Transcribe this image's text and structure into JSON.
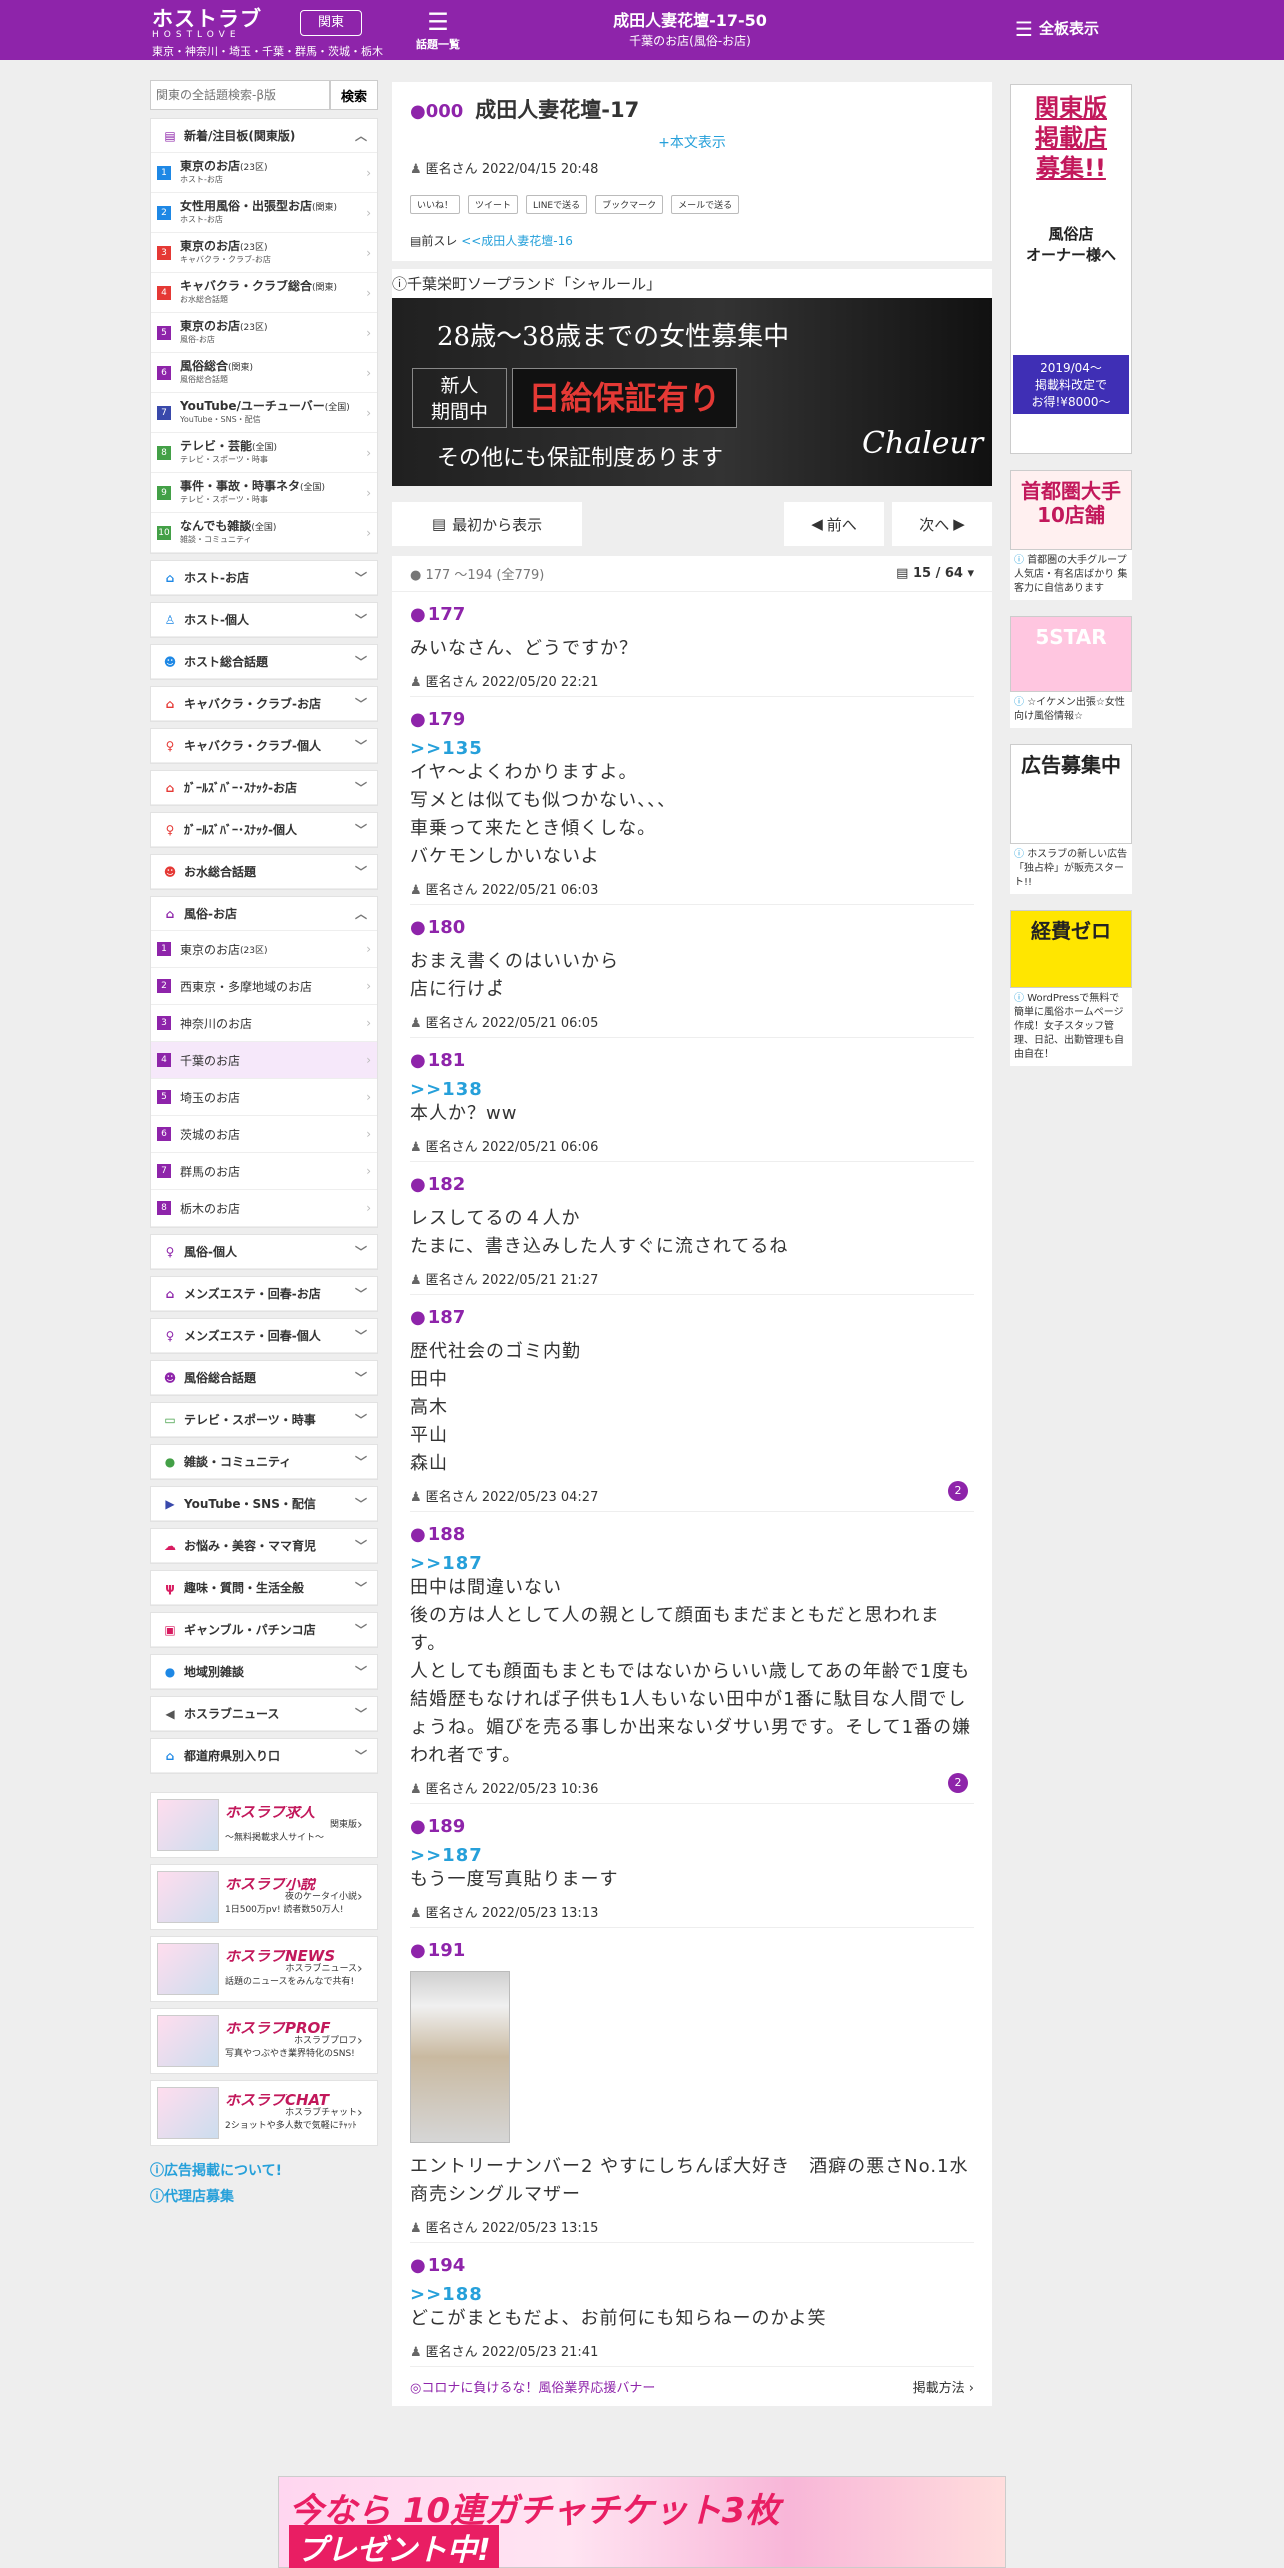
{
  "header": {
    "logo_jp": "ホストラブ",
    "logo_en": "HOSTLOVE",
    "region_btn": "関東",
    "areas": "東京・神奈川・埼玉・千葉・群馬・茨城・栃木",
    "topics_label": "話題一覧",
    "title": "成田人妻花壇-17-50",
    "subtitle": "千葉のお店(風俗-お店)",
    "fullview": "全板表示"
  },
  "search": {
    "placeholder": "関東の全話題検索-β版",
    "button": "検索"
  },
  "sidebar": {
    "featured_title": "新着/注目板(関東版)",
    "featured": [
      {
        "n": "1",
        "main": "東京のお店",
        "small": "(23区)",
        "sub": "ホスト-お店",
        "color": "#1e88e5"
      },
      {
        "n": "2",
        "main": "女性用風俗・出張型お店",
        "small": "(関東)",
        "sub": "ホスト-お店",
        "color": "#1e88e5"
      },
      {
        "n": "3",
        "main": "東京のお店",
        "small": "(23区)",
        "sub": "キャバクラ・クラブ-お店",
        "color": "#e53935"
      },
      {
        "n": "4",
        "main": "キャバクラ・クラブ総合",
        "small": "(関東)",
        "sub": "お水総合話題",
        "color": "#e53935"
      },
      {
        "n": "5",
        "main": "東京のお店",
        "small": "(23区)",
        "sub": "風俗-お店",
        "color": "#8e24aa"
      },
      {
        "n": "6",
        "main": "風俗総合",
        "small": "(関東)",
        "sub": "風俗総合話題",
        "color": "#8e24aa"
      },
      {
        "n": "7",
        "main": "YouTube/ユーチューバー",
        "small": "(全国)",
        "sub": "YouTube・SNS・配信",
        "color": "#3949ab"
      },
      {
        "n": "8",
        "main": "テレビ・芸能",
        "small": "(全国)",
        "sub": "テレビ・スポーツ・時事",
        "color": "#43a047"
      },
      {
        "n": "9",
        "main": "事件・事故・時事ネタ",
        "small": "(全国)",
        "sub": "テレビ・スポーツ・時事",
        "color": "#43a047"
      },
      {
        "n": "10",
        "main": "なんでも雑談",
        "small": "(全国)",
        "sub": "雑談・コミュニティ",
        "color": "#43a047"
      }
    ],
    "cats_top": [
      {
        "label": "ホスト-お店",
        "icon": "home-icon",
        "glyph": "⌂",
        "color": "#1e88e5"
      },
      {
        "label": "ホスト-個人",
        "icon": "person-icon",
        "glyph": "♙",
        "color": "#1e88e5"
      },
      {
        "label": "ホスト総合話題",
        "icon": "group-icon",
        "glyph": "☻",
        "color": "#1e88e5"
      },
      {
        "label": "キャバクラ・クラブ-お店",
        "icon": "home-icon",
        "glyph": "⌂",
        "color": "#e53935"
      },
      {
        "label": "キャバクラ・クラブ-個人",
        "icon": "person-icon",
        "glyph": "♀",
        "color": "#e53935"
      },
      {
        "label": "ｶﾞｰﾙｽﾞﾊﾞｰ･ｽﾅｯｸ-お店",
        "icon": "home-icon",
        "glyph": "⌂",
        "color": "#e53935"
      },
      {
        "label": "ｶﾞｰﾙｽﾞﾊﾞｰ･ｽﾅｯｸ-個人",
        "icon": "person-icon",
        "glyph": "♀",
        "color": "#e53935"
      },
      {
        "label": "お水総合話題",
        "icon": "group-icon",
        "glyph": "☻",
        "color": "#e53935"
      }
    ],
    "fuzoku_title": "風俗-お店",
    "fuzoku": [
      {
        "n": "1",
        "label": "東京のお店",
        "small": "(23区)"
      },
      {
        "n": "2",
        "label": "西東京・多摩地域のお店",
        "small": ""
      },
      {
        "n": "3",
        "label": "神奈川のお店",
        "small": ""
      },
      {
        "n": "4",
        "label": "千葉のお店",
        "small": ""
      },
      {
        "n": "5",
        "label": "埼玉のお店",
        "small": ""
      },
      {
        "n": "6",
        "label": "茨城のお店",
        "small": ""
      },
      {
        "n": "7",
        "label": "群馬のお店",
        "small": ""
      },
      {
        "n": "8",
        "label": "栃木のお店",
        "small": ""
      }
    ],
    "cats_bottom": [
      {
        "label": "風俗-個人",
        "icon": "person-icon",
        "glyph": "♀",
        "color": "#8e24aa"
      },
      {
        "label": "メンズエステ・回春-お店",
        "icon": "home-icon",
        "glyph": "⌂",
        "color": "#8e24aa"
      },
      {
        "label": "メンズエステ・回春-個人",
        "icon": "person-icon",
        "glyph": "♀",
        "color": "#8e24aa"
      },
      {
        "label": "風俗総合話題",
        "icon": "group-icon",
        "glyph": "☻",
        "color": "#8e24aa"
      },
      {
        "label": "テレビ・スポーツ・時事",
        "icon": "tv-icon",
        "glyph": "▭",
        "color": "#43a047"
      },
      {
        "label": "雑談・コミュニティ",
        "icon": "chat-icon",
        "glyph": "●",
        "color": "#43a047"
      },
      {
        "label": "YouTube・SNS・配信",
        "icon": "youtube-icon",
        "glyph": "▶",
        "color": "#3949ab"
      },
      {
        "label": "お悩み・美容・ママ育児",
        "icon": "cloud-icon",
        "glyph": "☁",
        "color": "#d81b60"
      },
      {
        "label": "趣味・質問・生活全般",
        "icon": "utensils-icon",
        "glyph": "ψ",
        "color": "#d81b60"
      },
      {
        "label": "ギャンブル・パチンコ店",
        "icon": "money-icon",
        "glyph": "▣",
        "color": "#d81b60"
      },
      {
        "label": "地域別雑談",
        "icon": "chat-icon",
        "glyph": "●",
        "color": "#1e88e5"
      },
      {
        "label": "ホスラブニュース",
        "icon": "speaker-icon",
        "glyph": "◀",
        "color": "#555555"
      },
      {
        "label": "都道府県別入り口",
        "icon": "home-icon",
        "glyph": "⌂",
        "color": "#1e88e5"
      }
    ],
    "ads": [
      {
        "title": "ホスラブ求人",
        "sub1": "関東版",
        "sub2": "〜無料掲載求人サイト〜"
      },
      {
        "title": "ホスラブ小説",
        "sub1": "夜のケータイ小説",
        "sub2": "1日500万pv! 読者数50万人!"
      },
      {
        "title": "ホスラブNEWS",
        "sub1": "ホスラブニュース",
        "sub2": "話題のニュースをみんなで共有!"
      },
      {
        "title": "ホスラブPROF",
        "sub1": "ホスラブプロフ",
        "sub2": "写真やつぶやき業界特化のSNS!"
      },
      {
        "title": "ホスラブCHAT",
        "sub1": "ホスラブチャット",
        "sub2": "2ショットや多人数で気軽にﾁｬｯﾄ"
      }
    ],
    "link1": "広告掲載について!",
    "link2": "代理店募集"
  },
  "thread": {
    "no": "000",
    "title": "成田人妻花壇-17",
    "more": "+本文表示",
    "author": "匿名さん",
    "date": "2022/04/15 20:48",
    "share": [
      "いいね！",
      "ツイート",
      "LINEで送る",
      "ブックマーク",
      "メールで送る"
    ],
    "prev_label": "前スレ",
    "prev_link": "<<成田人妻花壇-16"
  },
  "banner": {
    "heading": "千葉栄町ソープランド「シャルール」",
    "line1": "28歳〜38歳までの女性募集中",
    "new_label": "新人\n期間中",
    "big": "日給保証有り",
    "line3": "その他にも保証制度あります",
    "logo": "Chaleur"
  },
  "nav": {
    "first": "最初から表示",
    "prev": "前へ",
    "next": "次へ"
  },
  "list": {
    "range": "177 ～194",
    "total": "(全779)",
    "page": "15 / 64"
  },
  "posts": [
    {
      "no": "177",
      "ref": "",
      "body": "みいなさん、どうですか？",
      "author": "匿名さん",
      "date": "2022/05/20 22:21",
      "badge": ""
    },
    {
      "no": "179",
      "ref": ">>135",
      "body": "イヤ〜よくわかりますよ。\n写メとは似ても似つかない、、、\n車乗って来たとき傾くしな。\nバケモンしかいないよ",
      "author": "匿名さん",
      "date": "2022/05/21 06:03",
      "badge": ""
    },
    {
      "no": "180",
      "ref": "",
      "body": "おまえ書くのはいいから\n店に行けよ໋",
      "author": "匿名さん",
      "date": "2022/05/21 06:05",
      "badge": ""
    },
    {
      "no": "181",
      "ref": ">>138",
      "body": "本人か？ww",
      "author": "匿名さん",
      "date": "2022/05/21 06:06",
      "badge": ""
    },
    {
      "no": "182",
      "ref": "",
      "body": "レスしてるの４人か\nたまに、書き込みした人すぐに流されてるね",
      "author": "匿名さん",
      "date": "2022/05/21 21:27",
      "badge": ""
    },
    {
      "no": "187",
      "ref": "",
      "body": "歴代社会のゴミ内勤\n田中\n高木\n平山\n森山",
      "author": "匿名さん",
      "date": "2022/05/23 04:27",
      "badge": "2"
    },
    {
      "no": "188",
      "ref": ">>187",
      "body": "田中は間違いない\n後の方は人として人の親として顔面もまだまともだと思われます。\n人としても顔面もまともではないからいい歳してあの年齢で1度も結婚歴もなければ子供も1人もいない田中が1番に駄目な人間でしょうね。媚びを売る事しか出来ないダサい男です。そして1番の嫌われ者です。",
      "author": "匿名さん",
      "date": "2022/05/23 10:36",
      "badge": "2"
    },
    {
      "no": "189",
      "ref": ">>187",
      "body": "もう一度写真貼りまーす",
      "author": "匿名さん",
      "date": "2022/05/23 13:13",
      "badge": ""
    },
    {
      "no": "191",
      "ref": "",
      "photo": true,
      "body": "エントリーナンバー2 やすにしちんぽ大好き　酒癖の悪さNo.1水商売シングルマザー",
      "author": "匿名さん",
      "date": "2022/05/23 13:15",
      "badge": ""
    },
    {
      "no": "194",
      "ref": ">>188",
      "body": "どこがまともだよ、お前何にも知らねーのかよ笑",
      "author": "匿名さん",
      "date": "2022/05/23 21:41",
      "badge": ""
    }
  ],
  "corona": {
    "left": "◎コロナに負けるな！風俗業界応援バナー",
    "right": "掲載方法 ›"
  },
  "right_ads": [
    {
      "img_title": "関東版\n掲載店\n募集!!",
      "img_sub": "風俗店\nオーナー様へ",
      "img_price": "2019/04〜\n掲載料改定で\nお得!¥8000〜",
      "text": ""
    },
    {
      "img_title": "首都圏大手\n10店舗",
      "text": "首都圏の大手グループ 人気店・有名店ばかり 集客力に自信あります"
    },
    {
      "img_title": "5STAR",
      "text": "☆イケメン出張☆女性向け風俗情報☆"
    },
    {
      "img_title": "広告募集中",
      "text": "ホスラブの新しい広告「独占枠」が販売スタート!!"
    },
    {
      "img_title": "経費ゼロ",
      "text": "WordPressで無料で簡単に風俗ホームページ作成！女子スタッフ管理、日記、出勤管理も自由自在！"
    }
  ],
  "footer": {
    "line1": "今なら 10連ガチャチケット3枚",
    "line2": "プレゼント中!"
  }
}
